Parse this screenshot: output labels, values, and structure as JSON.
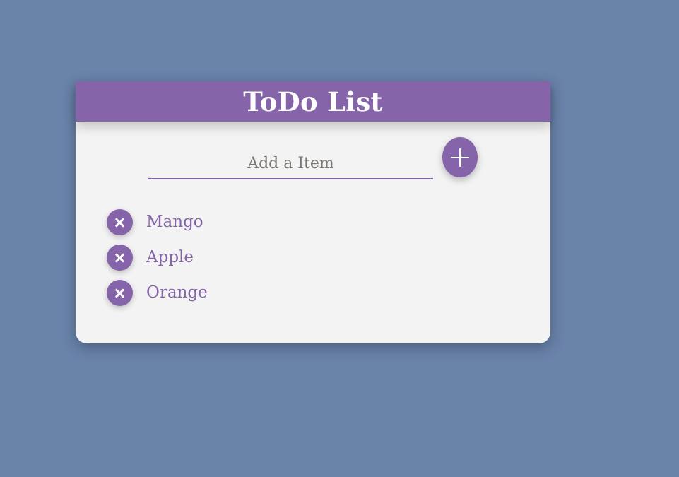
{
  "app": {
    "title": "ToDo List"
  },
  "input": {
    "placeholder": "Add a Item",
    "value": ""
  },
  "add_button": {
    "icon": "plus-icon"
  },
  "items": [
    {
      "label": "Mango",
      "remove_icon": "close-icon"
    },
    {
      "label": "Apple",
      "remove_icon": "close-icon"
    },
    {
      "label": "Orange",
      "remove_icon": "close-icon"
    }
  ],
  "colors": {
    "background": "#6a83a9",
    "accent": "#8664aa",
    "card": "#f3f3f3",
    "header_text": "#ffffff"
  }
}
